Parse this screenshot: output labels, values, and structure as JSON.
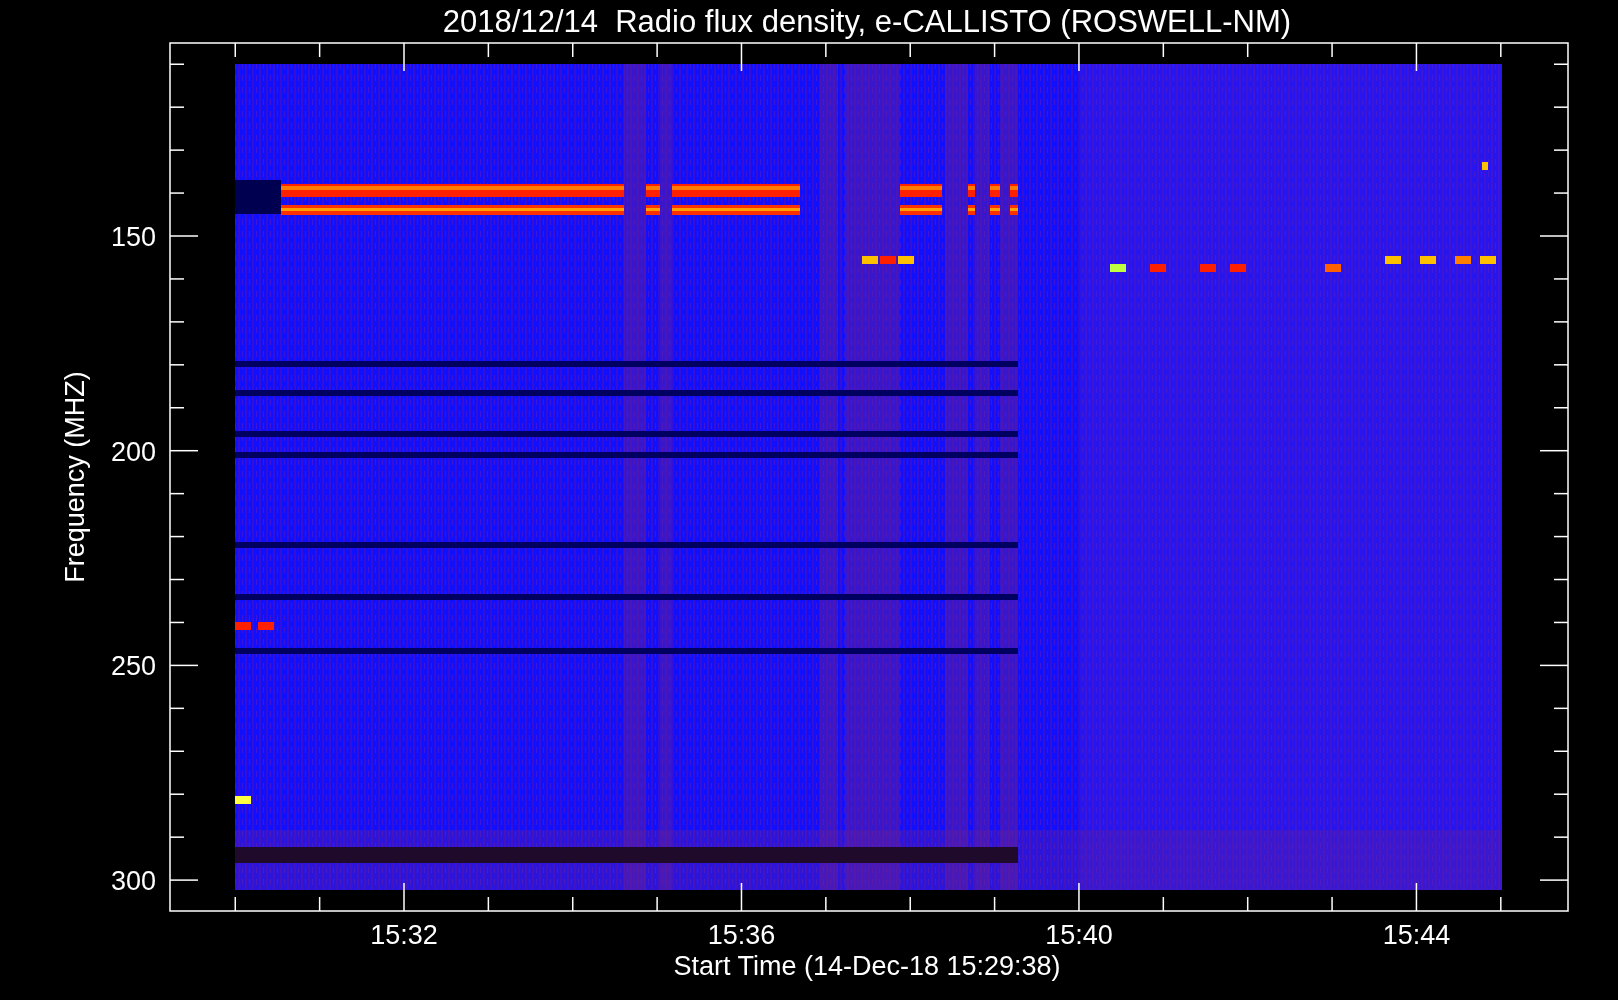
{
  "title": "2018/12/14  Radio flux density, e-CALLISTO (ROSWELL-NM)",
  "plot": {
    "ylabel": "Frequency (MHZ)",
    "y_tick_labels": [
      "150",
      "200",
      "250",
      "300"
    ],
    "x_tick_labels": [
      "15:32",
      "15:36",
      "15:40",
      "15:44"
    ],
    "xlabel": "Start Time (14-Dec-18 15:29:38)"
  }
}
